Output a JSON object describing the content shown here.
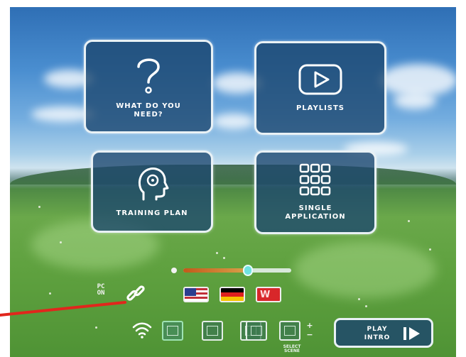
{
  "menu": {
    "tiles": [
      {
        "label_line1": "WHAT DO YOU",
        "label_line2": "NEED?",
        "icon": "question-mark-icon"
      },
      {
        "label_line1": "PLAYLISTS",
        "label_line2": "",
        "icon": "play-icon"
      },
      {
        "label_line1": "TRAINING PLAN",
        "label_line2": "",
        "icon": "head-profile-icon"
      },
      {
        "label_line1": "SINGLE",
        "label_line2": "APPLICATION",
        "icon": "grid-icon"
      }
    ]
  },
  "controls": {
    "volume_level": 0.6,
    "pc_label_line1": "PC",
    "pc_label_line2": "ON",
    "link_icon": "link-icon",
    "languages": [
      {
        "name": "us-flag",
        "color": "#c0303a"
      },
      {
        "name": "german-flag",
        "color": "#dd1f1f"
      },
      {
        "name": "red-flag",
        "color": "#d8272a",
        "mark": "W"
      }
    ],
    "wifi_icon": "wifi-icon",
    "thumbnails": [
      "scene-1",
      "scene-2",
      "scene-3",
      "scene-4",
      "scene-5"
    ],
    "select_label_line1": "SELECT",
    "select_label_line2": "SCENE",
    "plus": "+",
    "minus": "−",
    "play_intro_line1": "PLAY",
    "play_intro_line2": "INTRO"
  },
  "colors": {
    "tile_fill": "#1c466e",
    "tile_border": "#e9f1f5",
    "slider_thumb": "#6fe3e0",
    "annotation_arrow": "#e1261c"
  }
}
